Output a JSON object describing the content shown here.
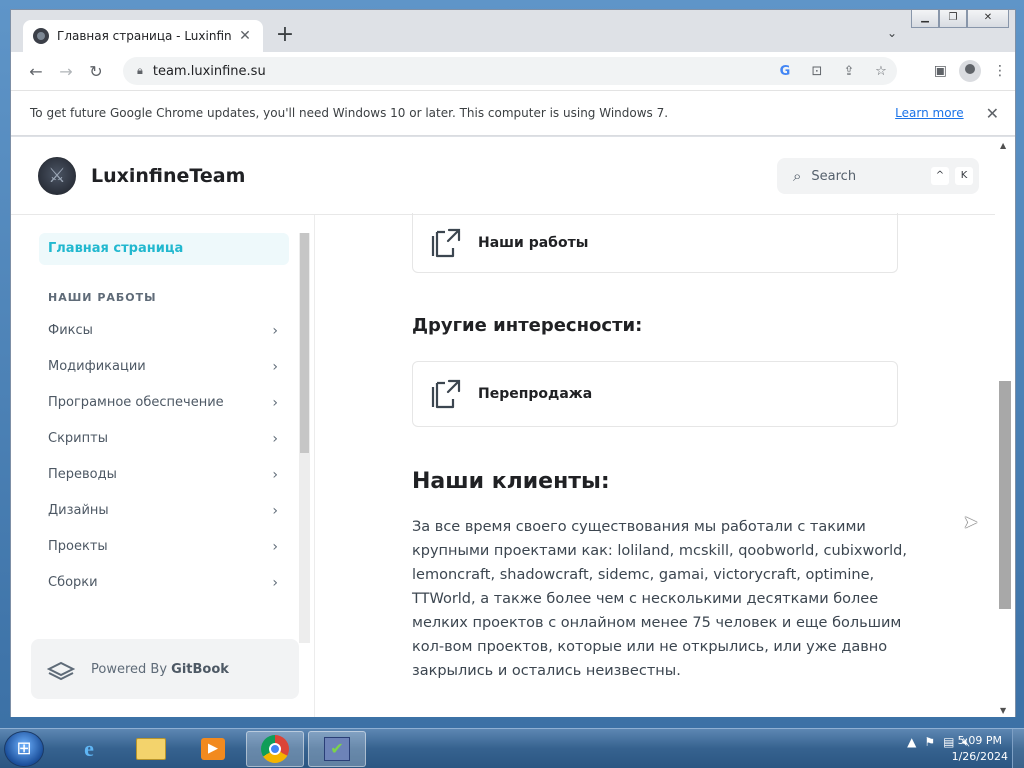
{
  "browser": {
    "tab_title": "Главная страница - LuxinfineTea",
    "tab_close": "✕",
    "new_tab": "+",
    "url": "team.luxinfine.su",
    "infobar_message": "To get future Google Chrome updates, you'll need Windows 10 or later. This computer is using Windows 7.",
    "infobar_link": "Learn more",
    "infobar_close": "✕"
  },
  "site": {
    "brand": "LuxinfineTeam",
    "search_placeholder": "Search",
    "search_kbd_1": "^",
    "search_kbd_2": "K"
  },
  "sidebar": {
    "active_item": "Главная страница",
    "section_title": "НАШИ РАБОТЫ",
    "items": [
      {
        "label": "Фиксы"
      },
      {
        "label": "Модификации"
      },
      {
        "label": "Програмное обеспечение"
      },
      {
        "label": "Скрипты"
      },
      {
        "label": "Переводы"
      },
      {
        "label": "Дизайны"
      },
      {
        "label": "Проекты"
      },
      {
        "label": "Сборки"
      }
    ],
    "powered_prefix": "Powered By",
    "powered_brand": "GitBook"
  },
  "main": {
    "card_works": "Наши работы",
    "other_heading": "Другие интересности:",
    "card_resale": "Перепродажа",
    "clients_heading": "Наши клиенты:",
    "clients_text": "За все время своего существования мы работали с такими крупными проектами как: loliland, mcskill, qoobworld, cubixworld, lemoncraft, shadowcraft, sidemc, gamai, victorycraft, optimine, TTWorld, а также более чем с несколькими десятками более мелких проектов с онлайном менее 75 человек и еще большим кол-вом проектов, которые или не открылись, или уже давно закрылись и остались неизвестны."
  },
  "taskbar": {
    "time": "5:09 PM",
    "date": "1/26/2024"
  }
}
